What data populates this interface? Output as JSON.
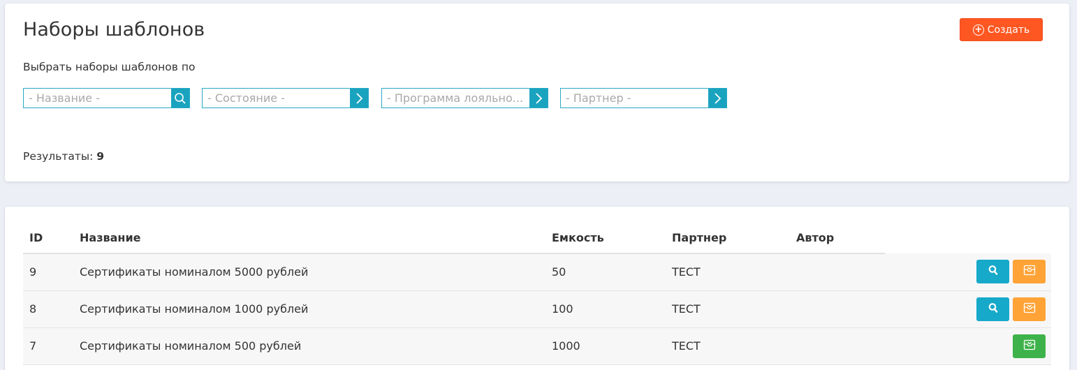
{
  "header": {
    "title": "Наборы шаблонов",
    "create_label": "Создать"
  },
  "filters": {
    "label": "Выбрать наборы шаблонов по",
    "name_placeholder": "- Название -",
    "state_placeholder": "- Состояние -",
    "program_placeholder": "- Программа лояльно...",
    "partner_placeholder": "- Партнер -"
  },
  "results": {
    "label": "Результаты:",
    "count": "9"
  },
  "table": {
    "columns": {
      "id": "ID",
      "name": "Название",
      "capacity": "Емкость",
      "partner": "Партнер",
      "author": "Автор"
    },
    "rows": [
      {
        "id": "9",
        "name": "Сертификаты номиналом 5000 рублей",
        "capacity": "50",
        "partner": "ТЕСТ",
        "author": ""
      },
      {
        "id": "8",
        "name": "Сертификаты номиналом 1000 рублей",
        "capacity": "100",
        "partner": "ТЕСТ",
        "author": ""
      },
      {
        "id": "7",
        "name": "Сертификаты номиналом 500 рублей",
        "capacity": "1000",
        "partner": "ТЕСТ",
        "author": ""
      }
    ]
  },
  "icons": {
    "view": "search-icon",
    "archive": "archive-box-icon",
    "create": "plus-circle-icon",
    "chevron": "chevron-right-icon"
  },
  "colors": {
    "create_button": "#ff5722",
    "accent_teal": "#1aa3bf",
    "archive_orange": "#ffa337",
    "archive_green": "#3eb24a"
  }
}
